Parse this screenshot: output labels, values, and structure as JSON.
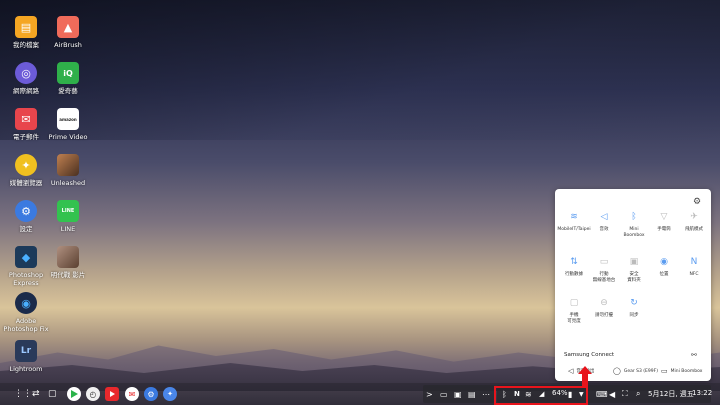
{
  "desktop_icons": [
    {
      "label": "我的檔案",
      "icon": "folder-icon",
      "color": "#f5a623"
    },
    {
      "label": "AirBrush",
      "icon": "airbrush-icon",
      "color": "#f06b5a"
    },
    {
      "label": "網際網路",
      "icon": "internet-icon",
      "color": "#6c5bd8"
    },
    {
      "label": "愛奇藝",
      "icon": "iqiyi-icon",
      "color": "#2fb04a"
    },
    {
      "label": "電子郵件",
      "icon": "email-icon",
      "color": "#e8454c"
    },
    {
      "label": "Prime Video",
      "icon": "prime-video-icon",
      "color": "#ffffff"
    },
    {
      "label": "媒體瀏覽器",
      "icon": "media-browser-icon",
      "color": "#f0c020"
    },
    {
      "label": "Unleashed",
      "icon": "unleashed-icon",
      "color": "#7a5a3a"
    },
    {
      "label": "設定",
      "icon": "settings-icon",
      "color": "#3b7ae0"
    },
    {
      "label": "LINE",
      "icon": "line-icon",
      "color": "#33c24f"
    },
    {
      "label": "Photoshop\nExpress",
      "icon": "photoshop-express-icon",
      "color": "#1c3a5a"
    },
    {
      "label": "明代戰 影片",
      "icon": "game-icon",
      "color": "#8a6a5a"
    },
    {
      "label": "Adobe\nPhotoshop Fix",
      "icon": "photoshop-fix-icon",
      "color": "#1b2b4a"
    },
    {
      "label": "Lightroom",
      "icon": "lightroom-icon",
      "color": "#2a3a5a"
    }
  ],
  "desktop_icon_glyphs": {
    "folder": "▤",
    "airbrush": "▲",
    "internet": "◎",
    "iqiyi": "iQ",
    "email": "✉",
    "prime": "amazon",
    "media": "✦",
    "settings": "⚙",
    "line": "LINE",
    "ps_express": "◆",
    "ps_fix": "◉",
    "lightroom": "Lr"
  },
  "taskbar": {
    "left_glyphs": [
      "⋮⋮",
      "⇄",
      "▢"
    ],
    "tray_left_glyphs": [
      ">",
      "▭",
      "▣",
      "▤",
      "⋯"
    ],
    "battery": "64%",
    "datetime": "5月12日, 週五",
    "time": "13:22"
  },
  "quick_panel": {
    "tiles": [
      {
        "label": "MobileIT/Taipei",
        "icon": "wifi-icon",
        "glyph": "≋",
        "on": true
      },
      {
        "label": "音效",
        "icon": "sound-icon",
        "glyph": "◁",
        "on": true
      },
      {
        "label": "Mini\nBoombox",
        "icon": "bluetooth-icon",
        "glyph": "ᛒ",
        "on": true
      },
      {
        "label": "手電筒",
        "icon": "flashlight-icon",
        "glyph": "▽",
        "on": false
      },
      {
        "label": "飛航模式",
        "icon": "airplane-icon",
        "glyph": "✈",
        "on": false
      },
      {
        "label": "行動數據",
        "icon": "mobile-data-icon",
        "glyph": "⇅",
        "on": true
      },
      {
        "label": "行動\n無線基地台",
        "icon": "hotspot-icon",
        "glyph": "▭",
        "on": false
      },
      {
        "label": "安全\n資料夾",
        "icon": "secure-folder-icon",
        "glyph": "▣",
        "on": false
      },
      {
        "label": "位置",
        "icon": "location-icon",
        "glyph": "◉",
        "on": true
      },
      {
        "label": "NFC",
        "icon": "nfc-icon",
        "glyph": "N",
        "on": true
      },
      {
        "label": "手機\n可見度",
        "icon": "visibility-icon",
        "glyph": "▢",
        "on": false
      },
      {
        "label": "請勿打擾",
        "icon": "do-not-disturb-icon",
        "glyph": "⊖",
        "on": false
      },
      {
        "label": "同步",
        "icon": "sync-icon",
        "glyph": "↻",
        "on": true
      }
    ],
    "samsung_connect": "Samsung Connect",
    "devices": [
      {
        "label": "音效輸出",
        "icon": "speaker-icon"
      },
      {
        "label": "Gear S3 (E99F)",
        "icon": "watch-icon"
      },
      {
        "label": "Mini Boombox",
        "icon": "boombox-icon"
      }
    ]
  }
}
